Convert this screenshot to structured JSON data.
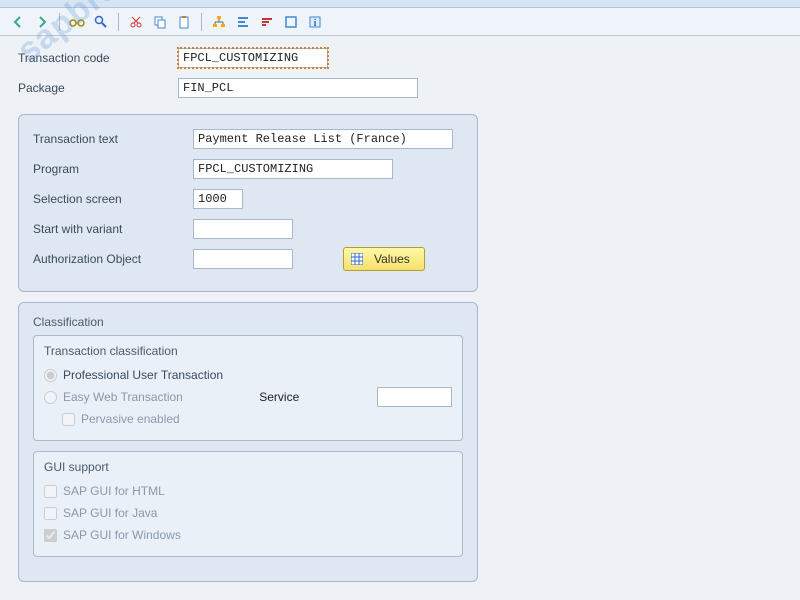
{
  "watermark": "sapbrainsonline.com",
  "header": {
    "transaction_code_label": "Transaction code",
    "transaction_code_value": "FPCL_CUSTOMIZING",
    "package_label": "Package",
    "package_value": "FIN_PCL"
  },
  "main": {
    "transaction_text_label": "Transaction text",
    "transaction_text_value": "Payment Release List (France)",
    "program_label": "Program",
    "program_value": "FPCL_CUSTOMIZING",
    "selection_screen_label": "Selection screen",
    "selection_screen_value": "1000",
    "start_with_variant_label": "Start with variant",
    "start_with_variant_value": "",
    "auth_object_label": "Authorization Object",
    "auth_object_value": "",
    "values_button": "Values"
  },
  "classification": {
    "title": "Classification",
    "sub1_title": "Transaction classification",
    "opt_professional": "Professional User Transaction",
    "opt_easyweb": "Easy Web Transaction",
    "service_label": "Service",
    "service_value": "",
    "opt_pervasive": "Pervasive enabled",
    "sub2_title": "GUI support",
    "gui_html": "SAP GUI for HTML",
    "gui_java": "SAP GUI for Java",
    "gui_windows": "SAP GUI for Windows"
  },
  "toolbar_icons": [
    "back",
    "forward",
    "save",
    "glasses",
    "find",
    "cut",
    "copy",
    "paste",
    "hierarchy",
    "align",
    "sort",
    "box",
    "info"
  ]
}
